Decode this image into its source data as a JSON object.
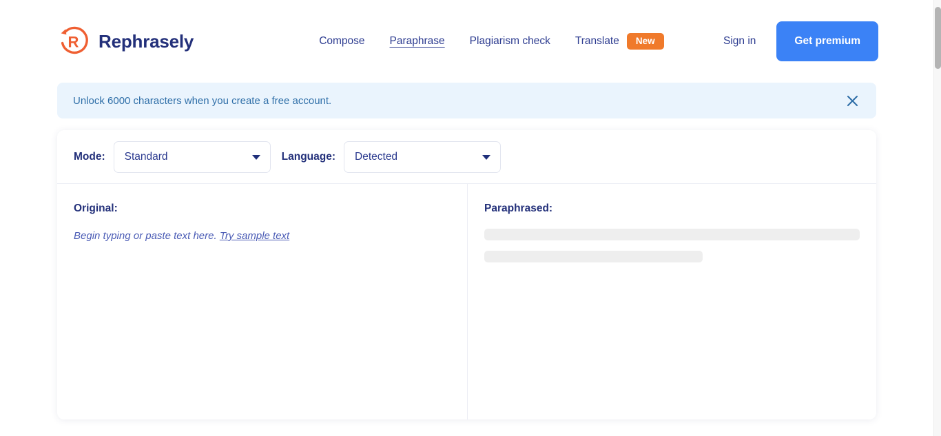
{
  "brand": {
    "name": "Rephrasely",
    "logo_icon": "circular-arrow-r-icon",
    "logo_color": "#ef5f32",
    "text_color": "#23307a"
  },
  "header": {
    "nav": [
      {
        "label": "Compose",
        "active": false
      },
      {
        "label": "Paraphrase",
        "active": true
      },
      {
        "label": "Plagiarism check",
        "active": false
      },
      {
        "label": "Translate",
        "active": false,
        "badge": "New"
      }
    ],
    "badge_color": "#f07a2b",
    "sign_in_label": "Sign in",
    "premium_button_label": "Get premium",
    "premium_button_color": "#3b82f6"
  },
  "notice": {
    "message": "Unlock 6000 characters when you create a free account.",
    "close_icon": "close-x-icon",
    "background_color": "#eaf4fd",
    "text_color": "#2f6fa8"
  },
  "toolbar": {
    "mode_label": "Mode:",
    "mode_value": "Standard",
    "language_label": "Language:",
    "language_value": "Detected",
    "caret_icon": "chevron-down-icon"
  },
  "editor": {
    "original": {
      "title": "Original:",
      "placeholder": "Begin typing or paste text here.",
      "sample_link": "Try sample text"
    },
    "paraphrased": {
      "title": "Paraphrased:",
      "skeleton_color": "#eeeeee"
    }
  }
}
